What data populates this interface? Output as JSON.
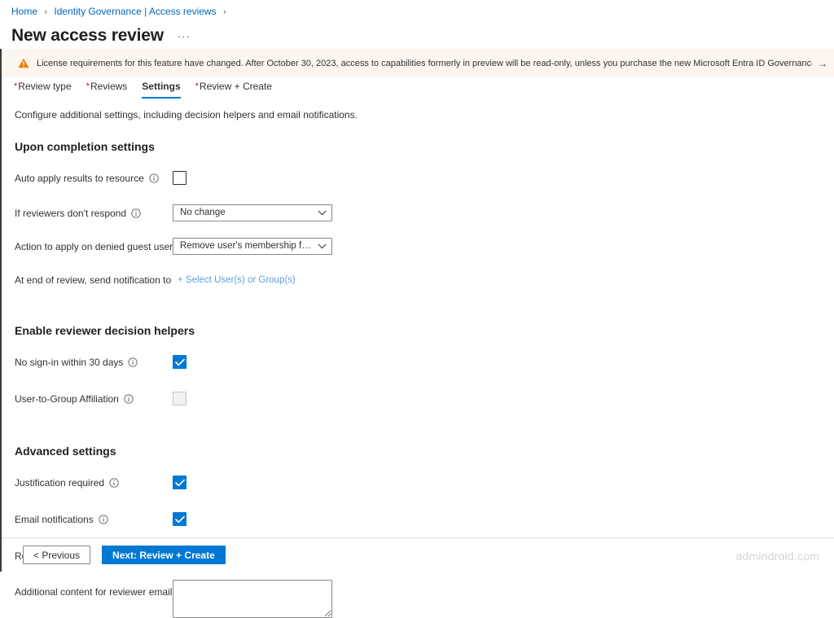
{
  "breadcrumb": {
    "items": [
      {
        "label": "Home"
      },
      {
        "label": "Identity Governance | Access reviews"
      }
    ],
    "separator": "›"
  },
  "header": {
    "title": "New access review",
    "more_label": "···"
  },
  "banner": {
    "icon": "warning-triangle-icon",
    "text": "License requirements for this feature have changed. After October 30, 2023, access to capabilities formerly in preview will be read-only, unless you purchase the new Microsoft Entra ID Governance license. Click here to learn more.",
    "arrow": "→",
    "background": "#fdf6f0",
    "icon_color": "#e8820c"
  },
  "tabs": [
    {
      "label": "Review type",
      "required": true,
      "active": false
    },
    {
      "label": "Reviews",
      "required": true,
      "active": false
    },
    {
      "label": "Settings",
      "required": false,
      "active": true
    },
    {
      "label": "Review + Create",
      "required": true,
      "active": false
    }
  ],
  "tab_required_marker": "*",
  "intro": "Configure additional settings, including decision helpers and email notifications.",
  "sections": [
    {
      "title": "Upon completion settings",
      "fields": [
        {
          "label": "Auto apply results to resource",
          "info": true,
          "control": "checkbox",
          "checked": false,
          "disabled": false
        },
        {
          "label": "If reviewers don't respond",
          "info": true,
          "control": "dropdown",
          "value": "No change"
        },
        {
          "label": "Action to apply on denied guest users",
          "info": true,
          "control": "dropdown",
          "value": "Remove user's membership from t..."
        },
        {
          "label": "At end of review, send notification to",
          "info": false,
          "control": "link",
          "value": "+ Select User(s) or Group(s)"
        }
      ]
    },
    {
      "title": "Enable reviewer decision helpers",
      "fields": [
        {
          "label": "No sign-in within 30 days",
          "info": true,
          "control": "checkbox",
          "checked": true,
          "disabled": false
        },
        {
          "label": "User-to-Group Affiliation",
          "info": true,
          "control": "checkbox",
          "checked": false,
          "disabled": true
        }
      ]
    },
    {
      "title": "Advanced settings",
      "fields": [
        {
          "label": "Justification required",
          "info": true,
          "control": "checkbox",
          "checked": true,
          "disabled": false
        },
        {
          "label": "Email notifications",
          "info": true,
          "control": "checkbox",
          "checked": true,
          "disabled": false
        },
        {
          "label": "Reminders",
          "info": true,
          "control": "checkbox",
          "checked": true,
          "disabled": false
        },
        {
          "label": "Additional content for reviewer email",
          "info": true,
          "control": "textarea",
          "value": "",
          "placeholder": ""
        }
      ]
    }
  ],
  "footer": {
    "previous_label": "< Previous",
    "next_label": "Next: Review + Create",
    "watermark": "admindroid.com"
  },
  "colors": {
    "accent": "#0078d4",
    "link": "#0067b8",
    "required": "#a4262c",
    "warning": "#e8820c"
  }
}
